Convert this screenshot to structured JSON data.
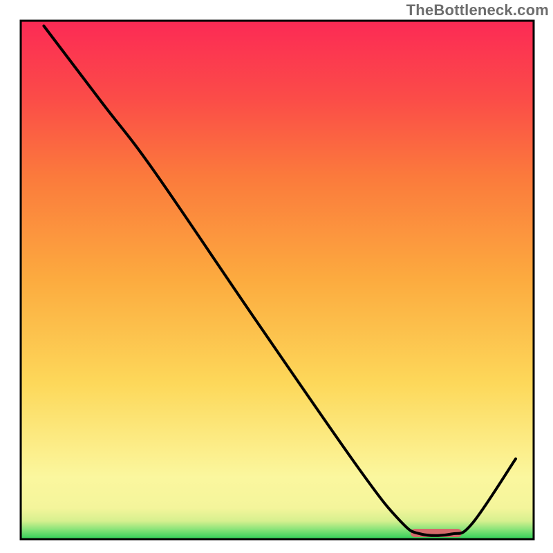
{
  "watermark": "TheBottleneck.com",
  "chart_data": {
    "type": "line",
    "title": "",
    "xlabel": "",
    "ylabel": "",
    "xlim": [
      0,
      100
    ],
    "ylim": [
      0,
      100
    ],
    "note": "No axis ticks or numeric labels are rendered in the image; values below are visual estimates on a 0–100 normalized scale, y measured from bottom (0) to top (100).",
    "gradient_stops": [
      {
        "offset": 0.0,
        "color": "#2ecf56"
      },
      {
        "offset": 0.02,
        "color": "#8ee57b"
      },
      {
        "offset": 0.035,
        "color": "#d6f08f"
      },
      {
        "offset": 0.06,
        "color": "#f4f59b"
      },
      {
        "offset": 0.12,
        "color": "#fbf79e"
      },
      {
        "offset": 0.3,
        "color": "#fdd85a"
      },
      {
        "offset": 0.5,
        "color": "#fcab3f"
      },
      {
        "offset": 0.7,
        "color": "#fb7a3c"
      },
      {
        "offset": 0.85,
        "color": "#fb4c48"
      },
      {
        "offset": 1.0,
        "color": "#fc2a55"
      }
    ],
    "series": [
      {
        "name": "curve",
        "points": [
          {
            "x": 4.5,
            "y": 99.0
          },
          {
            "x": 16.0,
            "y": 84.0
          },
          {
            "x": 26.0,
            "y": 71.0
          },
          {
            "x": 46.0,
            "y": 42.0
          },
          {
            "x": 66.0,
            "y": 13.5
          },
          {
            "x": 74.0,
            "y": 3.5
          },
          {
            "x": 78.0,
            "y": 1.0
          },
          {
            "x": 84.0,
            "y": 1.0
          },
          {
            "x": 88.0,
            "y": 3.0
          },
          {
            "x": 96.5,
            "y": 15.5
          }
        ]
      }
    ],
    "marker": {
      "name": "bottom-pill",
      "x_center": 81.0,
      "width": 10.0,
      "y": 1.2,
      "color": "#d46a6a"
    },
    "frame": {
      "stroke": "#000000",
      "stroke_width": 3
    }
  }
}
